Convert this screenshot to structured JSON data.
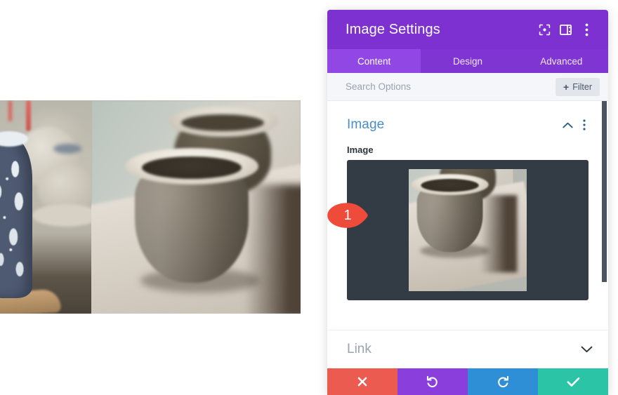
{
  "window": {
    "title": "Image Settings",
    "header_icons": [
      {
        "name": "fullscreen-icon",
        "label": "Fullscreen"
      },
      {
        "name": "layout-view-icon",
        "label": "Change Layout"
      },
      {
        "name": "more-options-icon",
        "label": "More Options"
      }
    ]
  },
  "tabs": [
    {
      "label": "Content",
      "active": true
    },
    {
      "label": "Design",
      "active": false
    },
    {
      "label": "Advanced",
      "active": false
    }
  ],
  "search": {
    "placeholder": "Search Options",
    "value": "",
    "filter_label": "Filter",
    "filter_plus": "+"
  },
  "sections": {
    "image": {
      "title": "Image",
      "collapse_icon": "chevron-up-icon",
      "options_icon": "more-options-icon",
      "field_label": "Image",
      "badge": "1"
    },
    "link": {
      "title": "Link",
      "expand_icon": "chevron-down-icon"
    }
  },
  "actions": [
    {
      "name": "cancel-button",
      "icon": "close-icon",
      "color": "#ec5b4f"
    },
    {
      "name": "undo-button",
      "icon": "undo-icon",
      "color": "#8a3fdd"
    },
    {
      "name": "redo-button",
      "icon": "redo-icon",
      "color": "#2e8fd6"
    },
    {
      "name": "save-button",
      "icon": "check-icon",
      "color": "#2bc4a7"
    }
  ],
  "colors": {
    "header_purple": "#7c31d0",
    "tabbar_purple": "#7e35d1",
    "active_tab_purple": "#9147e4",
    "section_title_blue": "#4a8ec2",
    "drop_zone_dark": "#333b45",
    "badge_red": "#ef4b3a",
    "scrollbar_thumb": "#4b5361"
  },
  "canvas": {
    "photos": [
      {
        "name": "photo-patterned-vase",
        "alt": "Blue patterned ceramic vase on wooden stand"
      },
      {
        "name": "photo-clay-pots",
        "alt": "Two unglazed clay pots on a board"
      }
    ]
  }
}
